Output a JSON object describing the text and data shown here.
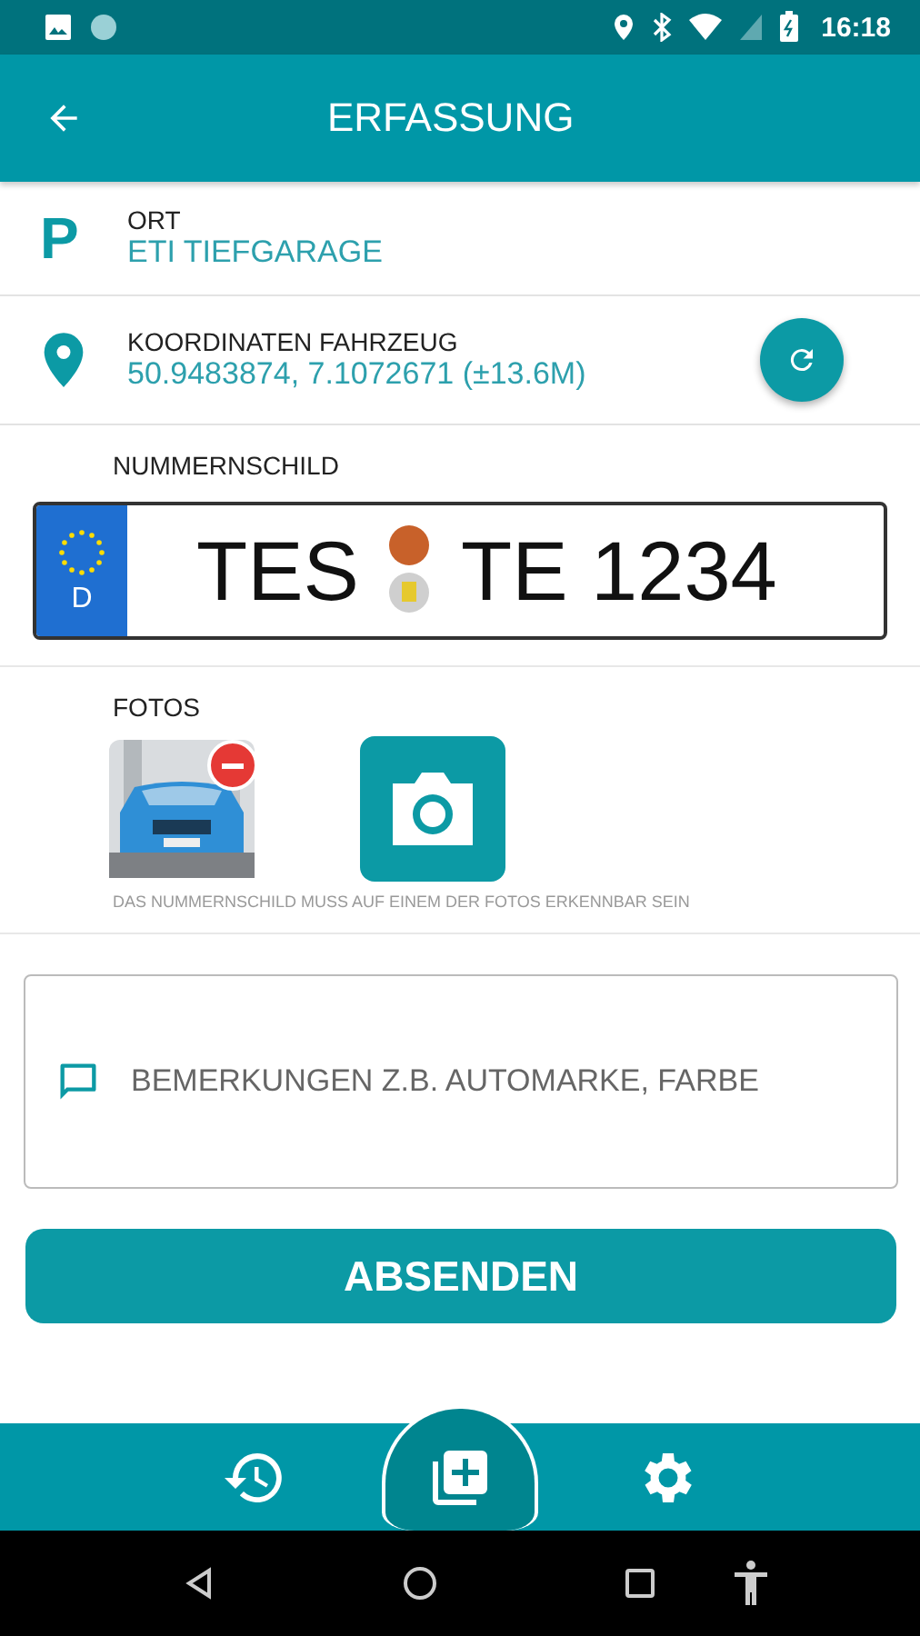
{
  "status_bar": {
    "time": "16:18"
  },
  "app_bar": {
    "title": "ERFASSUNG"
  },
  "location": {
    "label": "ORT",
    "value": "ETI TIEFGARAGE",
    "icon_letter": "P"
  },
  "coordinates": {
    "label": "KOORDINATEN FAHRZEUG",
    "value": "50.9483874, 7.1072671 (±13.6M)"
  },
  "plate": {
    "label": "NUMMERNSCHILD",
    "country": "D",
    "city": "TES",
    "number": "TE 1234"
  },
  "photos": {
    "label": "FOTOS",
    "hint": "DAS NUMMERNSCHILD MUSS AUF EINEM DER FOTOS ERKENNBAR SEIN"
  },
  "remarks": {
    "placeholder": "BEMERKUNGEN Z.B. AUTOMARKE, FARBE"
  },
  "submit": {
    "label": "ABSENDEN"
  },
  "bottom_nav": [
    {
      "kind": "history",
      "selected": false
    },
    {
      "kind": "add",
      "selected": true
    },
    {
      "kind": "settings",
      "selected": false
    }
  ]
}
